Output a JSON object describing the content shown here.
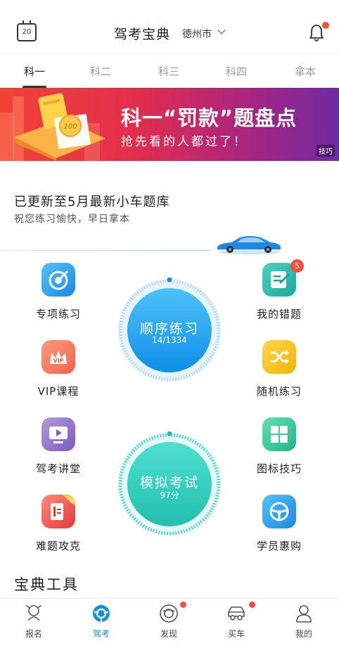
{
  "header": {
    "calendar_day": "20",
    "title": "驾考宝典",
    "city": "德州市"
  },
  "tabs": [
    {
      "label": "科一",
      "active": true
    },
    {
      "label": "科二",
      "active": false
    },
    {
      "label": "科三",
      "active": false
    },
    {
      "label": "科四",
      "active": false
    },
    {
      "label": "拿本",
      "active": false
    }
  ],
  "banner": {
    "title": "科一“罚款”题盘点",
    "subtitle": "抢先看的人都过了！",
    "tag": "技巧",
    "art_number": "100"
  },
  "update": {
    "title": "已更新至5月最新小车题库",
    "subtitle": "祝您练习愉快，早日拿本"
  },
  "features": {
    "special_practice": "专项练习",
    "my_mistakes": "我的错题",
    "mistakes_badge": "5",
    "vip_course": "VIP课程",
    "vip_icon_text": "VIP",
    "random_practice": "随机练习",
    "lecture_hall": "驾考讲堂",
    "sign_tips": "图标技巧",
    "hard_questions": "难题攻克",
    "hard_icon_tag": "必做",
    "student_deals": "学员惠购"
  },
  "sequential": {
    "label": "顺序练习",
    "progress": "14/1334"
  },
  "mock_exam": {
    "label": "模拟考试",
    "score": "97分"
  },
  "tools": {
    "title": "宝典工具"
  },
  "bottom_nav": [
    {
      "label": "报名",
      "active": false,
      "dot": false
    },
    {
      "label": "驾考",
      "active": true,
      "dot": false
    },
    {
      "label": "发现",
      "active": false,
      "dot": true
    },
    {
      "label": "买车",
      "active": false,
      "dot": true
    },
    {
      "label": "我的",
      "active": false,
      "dot": false
    }
  ],
  "colors": {
    "accent_blue": "#1a8de0",
    "alert_red": "#f4503a",
    "teal": "#2fd1c4"
  }
}
